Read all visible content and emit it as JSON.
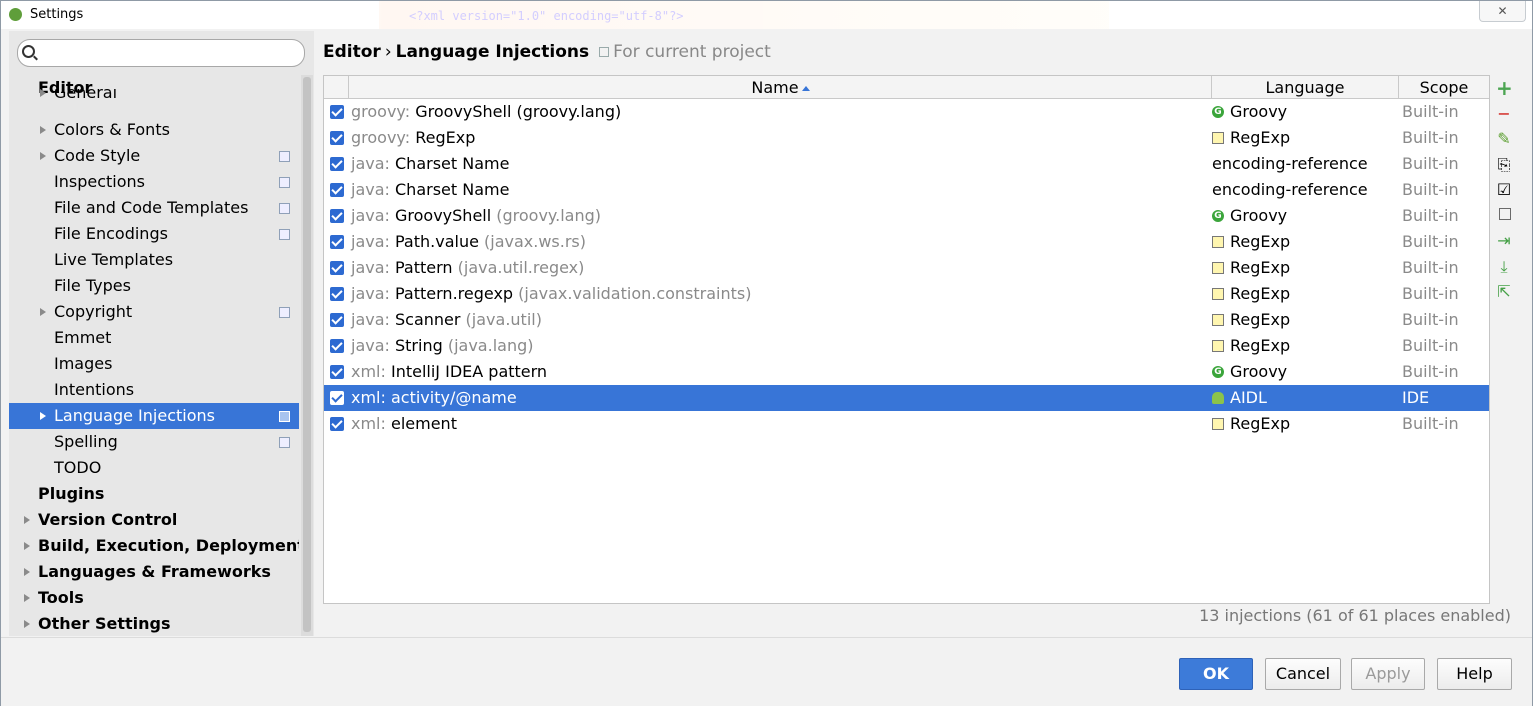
{
  "window": {
    "title": "Settings",
    "close_label": "✕",
    "bg_code": "<?xml version=\"1.0\" encoding=\"utf-8\"?>"
  },
  "search": {
    "value": "",
    "placeholder": ""
  },
  "tree": [
    {
      "label": "Editor",
      "level": 0,
      "bold": true,
      "arrow": false,
      "icon": false
    },
    {
      "label": "General",
      "level": 1,
      "arrow": true,
      "icon": false,
      "partial": true
    },
    {
      "label": "Colors & Fonts",
      "level": 1,
      "arrow": true,
      "icon": false
    },
    {
      "label": "Code Style",
      "level": 1,
      "arrow": true,
      "icon": true
    },
    {
      "label": "Inspections",
      "level": 1,
      "arrow": false,
      "icon": true
    },
    {
      "label": "File and Code Templates",
      "level": 1,
      "arrow": false,
      "icon": true
    },
    {
      "label": "File Encodings",
      "level": 1,
      "arrow": false,
      "icon": true
    },
    {
      "label": "Live Templates",
      "level": 1,
      "arrow": false,
      "icon": false
    },
    {
      "label": "File Types",
      "level": 1,
      "arrow": false,
      "icon": false
    },
    {
      "label": "Copyright",
      "level": 1,
      "arrow": true,
      "icon": true
    },
    {
      "label": "Emmet",
      "level": 1,
      "arrow": false,
      "icon": false
    },
    {
      "label": "Images",
      "level": 1,
      "arrow": false,
      "icon": false
    },
    {
      "label": "Intentions",
      "level": 1,
      "arrow": false,
      "icon": false
    },
    {
      "label": "Language Injections",
      "level": 1,
      "arrow": true,
      "icon": true,
      "selected": true
    },
    {
      "label": "Spelling",
      "level": 1,
      "arrow": false,
      "icon": true
    },
    {
      "label": "TODO",
      "level": 1,
      "arrow": false,
      "icon": false
    },
    {
      "label": "Plugins",
      "level": 0,
      "bold": true,
      "arrow": false,
      "icon": false
    },
    {
      "label": "Version Control",
      "level": 0,
      "bold": true,
      "arrow": true,
      "icon": false
    },
    {
      "label": "Build, Execution, Deployment",
      "level": 0,
      "bold": true,
      "arrow": true,
      "icon": false
    },
    {
      "label": "Languages & Frameworks",
      "level": 0,
      "bold": true,
      "arrow": true,
      "icon": false
    },
    {
      "label": "Tools",
      "level": 0,
      "bold": true,
      "arrow": true,
      "icon": false
    },
    {
      "label": "Other Settings",
      "level": 0,
      "bold": true,
      "arrow": true,
      "icon": false
    }
  ],
  "breadcrumb": {
    "parent": "Editor",
    "separator": "›",
    "current": "Language Injections",
    "scope": "For current project"
  },
  "table": {
    "columns": {
      "name": "Name",
      "language": "Language",
      "scope": "Scope"
    },
    "rows": [
      {
        "checked": true,
        "prefix": "groovy: ",
        "name": "GroovyShell (groovy.lang)",
        "suffix": "",
        "language": "Groovy",
        "lang_icon": "groovy",
        "scope": "Built-in"
      },
      {
        "checked": true,
        "prefix": "groovy: ",
        "name": "RegExp",
        "suffix": "",
        "language": "RegExp",
        "lang_icon": "regexp",
        "scope": "Built-in"
      },
      {
        "checked": true,
        "prefix": "java: ",
        "name": "Charset Name",
        "suffix": "",
        "language": "encoding-reference",
        "lang_icon": "",
        "scope": "Built-in"
      },
      {
        "checked": true,
        "prefix": "java: ",
        "name": "Charset Name",
        "suffix": "",
        "language": "encoding-reference",
        "lang_icon": "",
        "scope": "Built-in"
      },
      {
        "checked": true,
        "prefix": "java: ",
        "name": "GroovyShell",
        "suffix": " (groovy.lang)",
        "language": "Groovy",
        "lang_icon": "groovy",
        "scope": "Built-in"
      },
      {
        "checked": true,
        "prefix": "java: ",
        "name": "Path.value",
        "suffix": " (javax.ws.rs)",
        "language": "RegExp",
        "lang_icon": "regexp",
        "scope": "Built-in"
      },
      {
        "checked": true,
        "prefix": "java: ",
        "name": "Pattern",
        "suffix": " (java.util.regex)",
        "language": "RegExp",
        "lang_icon": "regexp",
        "scope": "Built-in"
      },
      {
        "checked": true,
        "prefix": "java: ",
        "name": "Pattern.regexp",
        "suffix": " (javax.validation.constraints)",
        "language": "RegExp",
        "lang_icon": "regexp",
        "scope": "Built-in"
      },
      {
        "checked": true,
        "prefix": "java: ",
        "name": "Scanner",
        "suffix": " (java.util)",
        "language": "RegExp",
        "lang_icon": "regexp",
        "scope": "Built-in"
      },
      {
        "checked": true,
        "prefix": "java: ",
        "name": "String",
        "suffix": " (java.lang)",
        "language": "RegExp",
        "lang_icon": "regexp",
        "scope": "Built-in"
      },
      {
        "checked": true,
        "prefix": "xml: ",
        "name": "IntelliJ IDEA pattern",
        "suffix": "",
        "language": "Groovy",
        "lang_icon": "groovy",
        "scope": "Built-in"
      },
      {
        "checked": true,
        "prefix": "xml: ",
        "name": "activity/@name",
        "suffix": "",
        "language": "AIDL",
        "lang_icon": "android",
        "scope": "IDE",
        "selected": true
      },
      {
        "checked": true,
        "prefix": "xml: ",
        "name": "element",
        "suffix": "",
        "language": "RegExp",
        "lang_icon": "regexp",
        "scope": "Built-in"
      }
    ]
  },
  "toolbar": [
    {
      "name": "add-icon",
      "glyph": "+",
      "cls": "add"
    },
    {
      "name": "remove-icon",
      "glyph": "−",
      "cls": "remove"
    },
    {
      "name": "edit-icon",
      "glyph": "✎",
      "cls": "edit"
    },
    {
      "name": "copy-icon",
      "glyph": "⎘",
      "cls": ""
    },
    {
      "name": "enable-all-icon",
      "glyph": "☑",
      "cls": ""
    },
    {
      "name": "duplicate-icon",
      "glyph": "",
      "cls": "box"
    },
    {
      "name": "import-icon",
      "glyph": "⇥",
      "cls": "green"
    },
    {
      "name": "download-icon",
      "glyph": "⤓",
      "cls": "green"
    },
    {
      "name": "export-icon",
      "glyph": "⇱",
      "cls": "green"
    }
  ],
  "status": "13 injections (61 of 61 places enabled)",
  "buttons": {
    "ok": "OK",
    "cancel": "Cancel",
    "apply": "Apply",
    "help": "Help"
  }
}
